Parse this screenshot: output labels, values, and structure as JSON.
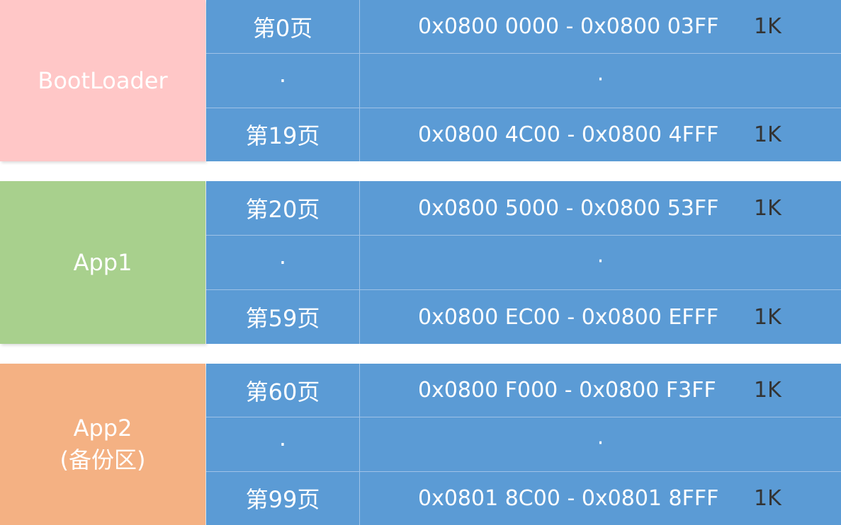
{
  "colors": {
    "bootloader": "#ffc7c7",
    "app1": "#a8d08d",
    "app2": "#f4b183",
    "table": "#5b9bd5",
    "divider": "#9fc2e7",
    "size_text": "#333333"
  },
  "regions": [
    {
      "label_lines": [
        "BootLoader"
      ],
      "rows": [
        {
          "page": "第0页",
          "address": "0x0800 0000 - 0x0800 03FF",
          "size": "1K"
        },
        {
          "page": "·",
          "address": "·",
          "size": ""
        },
        {
          "page": "第19页",
          "address": "0x0800 4C00 - 0x0800 4FFF",
          "size": "1K"
        }
      ]
    },
    {
      "label_lines": [
        "App1"
      ],
      "rows": [
        {
          "page": "第20页",
          "address": "0x0800 5000 - 0x0800 53FF",
          "size": "1K"
        },
        {
          "page": "·",
          "address": "·",
          "size": ""
        },
        {
          "page": "第59页",
          "address": "0x0800 EC00 - 0x0800 EFFF",
          "size": "1K"
        }
      ]
    },
    {
      "label_lines": [
        "App2",
        "(备份区)"
      ],
      "rows": [
        {
          "page": "第60页",
          "address": "0x0800 F000 - 0x0800 F3FF",
          "size": "1K"
        },
        {
          "page": "·",
          "address": "·",
          "size": ""
        },
        {
          "page": "第99页",
          "address": "0x0801 8C00 - 0x0801 8FFF",
          "size": "1K"
        }
      ]
    }
  ]
}
